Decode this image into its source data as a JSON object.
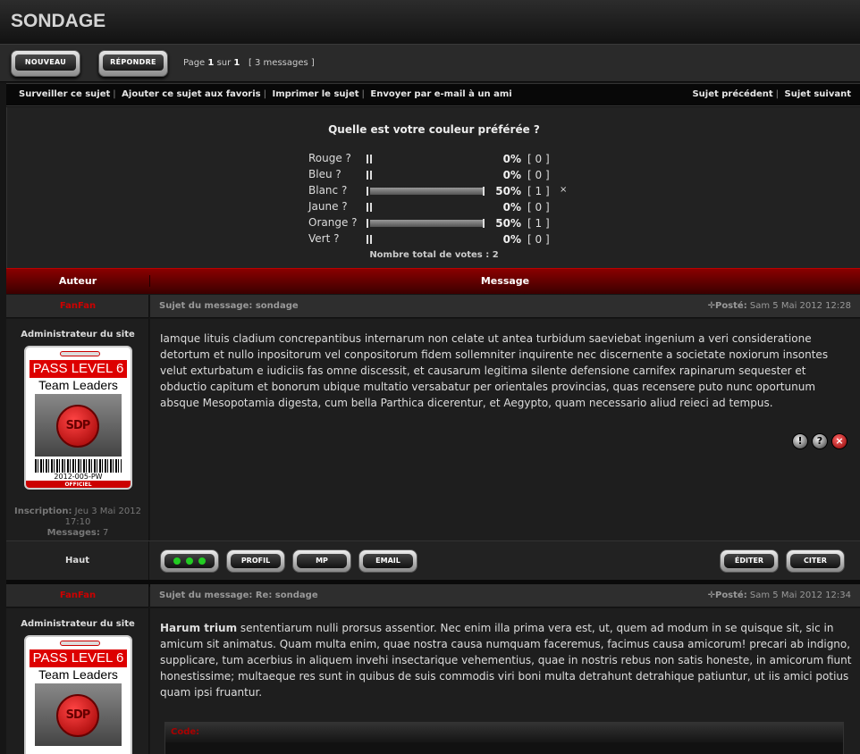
{
  "page": {
    "title": "SONDAGE"
  },
  "toolbar": {
    "new_label": "NOUVEAU",
    "reply_label": "RÉPONDRE",
    "page_prefix": "Page",
    "page_current": "1",
    "page_sep": "sur",
    "page_total": "1",
    "messages": "[ 3 messages ]"
  },
  "links": {
    "left": [
      "Surveiller ce sujet",
      "Ajouter ce sujet aux favoris",
      "Imprimer le sujet",
      "Envoyer par e-mail à un ami"
    ],
    "right": [
      "Sujet précédent",
      "Sujet suivant"
    ]
  },
  "poll": {
    "question": "Quelle est votre couleur préférée ?",
    "options": [
      {
        "label": "Rouge ?",
        "percent": "0%",
        "votes": "[ 0 ]",
        "fraction": 0,
        "mark": ""
      },
      {
        "label": "Bleu ?",
        "percent": "0%",
        "votes": "[ 0 ]",
        "fraction": 0,
        "mark": ""
      },
      {
        "label": "Blanc ?",
        "percent": "50%",
        "votes": "[ 1 ]",
        "fraction": 0.5,
        "mark": "×"
      },
      {
        "label": "Jaune ?",
        "percent": "0%",
        "votes": "[ 0 ]",
        "fraction": 0,
        "mark": ""
      },
      {
        "label": "Orange ?",
        "percent": "50%",
        "votes": "[ 1 ]",
        "fraction": 0.5,
        "mark": ""
      },
      {
        "label": "Vert ?",
        "percent": "0%",
        "votes": "[ 0 ]",
        "fraction": 0,
        "mark": ""
      }
    ],
    "total": "Nombre total de votes : 2"
  },
  "table": {
    "col_author": "Auteur",
    "col_message": "Message"
  },
  "posts": [
    {
      "author": "FanFan",
      "subject_prefix": "Sujet du message:",
      "subject": "sondage",
      "posted_label": "Posté:",
      "posted_date": "Sam 5 Mai 2012 12:28",
      "role": "Administrateur du site",
      "badge": {
        "line1": "PASS LEVEL 6",
        "line2": "Team Leaders",
        "logo": "SDP",
        "code": "2012-005-PW",
        "footer": "OFFICIEL"
      },
      "inscription_label": "Inscription:",
      "inscription": "Jeu 3 Mai 2012 17:10",
      "messages_label": "Messages:",
      "messages": "7",
      "body_bold": "",
      "body": "Iamque lituis cladium concrepantibus internarum non celate ut antea turbidum saeviebat ingenium a veri consideratione detortum et nullo inpositorum vel conpositorum fidem sollemniter inquirente nec discernente a societate noxiorum insontes velut exturbatum e iudiciis fas omne discessit, et causarum legitima silente defensione carnifex rapinarum sequester et obductio capitum et bonorum ubique multatio versabatur per orientales provincias, quas recensere puto nunc oportunum absque Mesopotamia digesta, cum bella Parthica dicerentur, et Aegypto, quam necessario aliud reieci ad tempus."
    },
    {
      "author": "FanFan",
      "subject_prefix": "Sujet du message:",
      "subject": "Re: sondage",
      "posted_label": "Posté:",
      "posted_date": "Sam 5 Mai 2012 12:34",
      "role": "Administrateur du site",
      "badge": {
        "line1": "PASS LEVEL 6",
        "line2": "Team Leaders",
        "logo": "SDP"
      },
      "body_bold": "Harum trium",
      "body": " sententiarum nulli prorsus assentior. Nec enim illa prima vera est, ut, quem ad modum in se quisque sit, sic in amicum sit animatus. Quam multa enim, quae nostra causa numquam faceremus, facimus causa amicorum! precari ab indigno, supplicare, tum acerbius in aliquem invehi insectarique vehementius, quae in nostris rebus non satis honeste, in amicorum fiunt honestissime; multaeque res sunt in quibus de suis commodis viri boni multa detrahunt detrahique patiuntur, ut iis amici potius quam ipsi fruantur.",
      "code_label": "Code:"
    }
  ],
  "footer": {
    "top_label": "Haut",
    "profile": "PROFIL",
    "pm": "MP",
    "email": "EMAIL",
    "edit": "ÉDITER",
    "quote": "CITER"
  }
}
